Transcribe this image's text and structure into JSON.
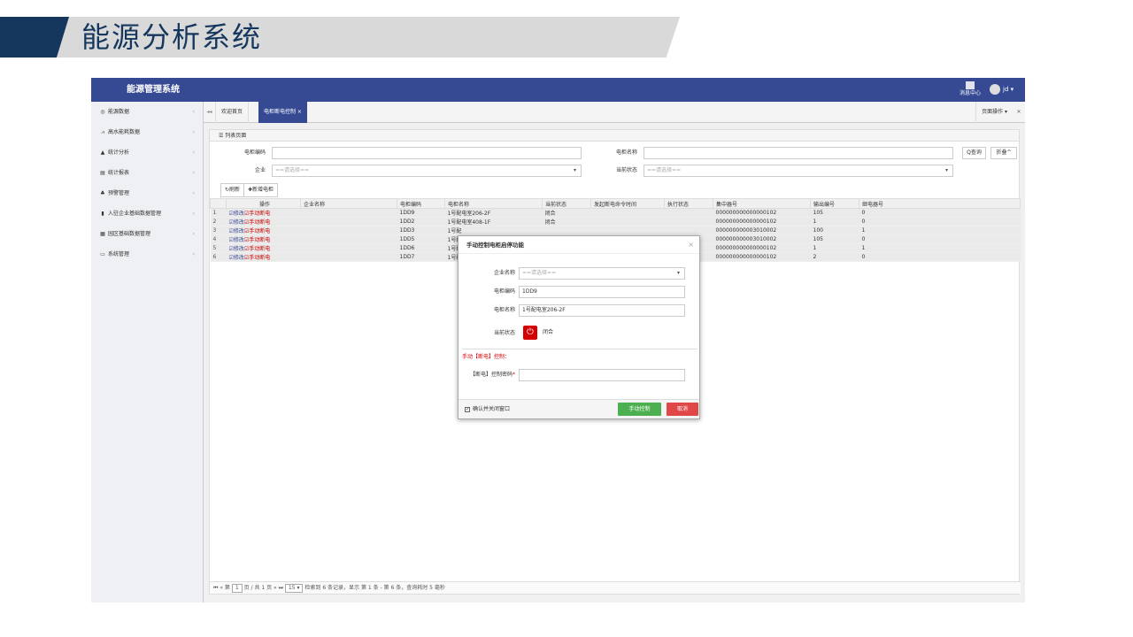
{
  "banner": {
    "title": "能源分析系统"
  },
  "header": {
    "app_title": "能源管理系统",
    "message_center": "消息中心",
    "user": "jd ▾"
  },
  "sidebar": {
    "items": [
      {
        "icon": "dashboard-icon",
        "glyph": "◎",
        "label": "能源数据"
      },
      {
        "icon": "tower-icon",
        "glyph": "⩘",
        "label": "高水能耗数据"
      },
      {
        "icon": "chart-icon",
        "glyph": "▲",
        "label": "统计分析"
      },
      {
        "icon": "table-icon",
        "glyph": "▤",
        "label": "统计报表"
      },
      {
        "icon": "bell-icon",
        "glyph": "♣",
        "label": "预警管理"
      },
      {
        "icon": "building-icon",
        "glyph": "▮",
        "label": "入驻企业基础数据管理"
      },
      {
        "icon": "park-icon",
        "glyph": "▦",
        "label": "园区基础数据管理"
      },
      {
        "icon": "monitor-icon",
        "glyph": "▭",
        "label": "系统管理"
      }
    ]
  },
  "tabs": {
    "first": "◂◂",
    "home": "欢迎首页",
    "active": "电柜断电控制 ×",
    "page_op": "页面操作 ▾",
    "fullscreen": "✕"
  },
  "search": {
    "list_title": "☰ 列表页面",
    "code_label": "电柜编码",
    "name_label": "电柜名称",
    "company_label": "企业",
    "company_placeholder": "==请选择==",
    "state_label": "当前状态",
    "state_placeholder": "==请选择==",
    "query": "Q查询",
    "collapse": "折叠^"
  },
  "toolbar": {
    "refresh": "↻刷新",
    "add": "✚新增电柜"
  },
  "grid": {
    "headers": [
      "",
      "操作",
      "企业名称",
      "电柜编码",
      "电柜名称",
      "当前状态",
      "发起断电命令时间",
      "执行状态",
      "集中器号",
      "输出编号",
      "继电器号"
    ],
    "rows": [
      {
        "n": "1",
        "edit": "☑修改",
        "cut": "☑手动断电",
        "company": "",
        "code": "1DD9",
        "name": "1号配电室206-2F",
        "state": "闭合",
        "time": "",
        "exec": "",
        "conc": "000000000000000102",
        "out": "105",
        "relay": "0"
      },
      {
        "n": "2",
        "edit": "☑修改",
        "cut": "☑手动断电",
        "company": "",
        "code": "1DD2",
        "name": "1号配电室408-1F",
        "state": "闭合",
        "time": "",
        "exec": "",
        "conc": "000000000000000102",
        "out": "1",
        "relay": "0"
      },
      {
        "n": "3",
        "edit": "☑修改",
        "cut": "☑手动断电",
        "company": "",
        "code": "1DD3",
        "name": "1号配",
        "state": "",
        "time": "",
        "exec": "",
        "conc": "000000000003010002",
        "out": "100",
        "relay": "1"
      },
      {
        "n": "4",
        "edit": "☑修改",
        "cut": "☑手动断电",
        "company": "",
        "code": "1DD5",
        "name": "1号配",
        "state": "",
        "time": "",
        "exec": "",
        "conc": "000000000003010002",
        "out": "105",
        "relay": "0"
      },
      {
        "n": "5",
        "edit": "☑修改",
        "cut": "☑手动断电",
        "company": "",
        "code": "1DD6",
        "name": "1号配",
        "state": "",
        "time": "",
        "exec": "",
        "conc": "000000000000000102",
        "out": "1",
        "relay": "1"
      },
      {
        "n": "6",
        "edit": "☑修改",
        "cut": "☑手动断电",
        "company": "",
        "code": "1DD7",
        "name": "1号配",
        "state": "",
        "time": "",
        "exec": "",
        "conc": "000000000000000102",
        "out": "2",
        "relay": "0"
      }
    ]
  },
  "pager": {
    "first": "⏮",
    "prev": "«",
    "page_prefix": "第",
    "page": "1",
    "page_suffix": "页 / 共 1 页",
    "next": "»",
    "last": "⏭",
    "size": "15 ▾",
    "summary": "检索到 6 条记录，显示 第 1 条 - 第 6 条，查询耗时 5 毫秒"
  },
  "modal": {
    "title": "手动控制电柜启停功能",
    "close": "×",
    "company_label": "企业名称",
    "company_placeholder": "==请选择==",
    "code_label": "电柜编码",
    "code_value": "1DD9",
    "name_label": "电柜名称",
    "name_value": "1号配电室206-2F",
    "state_label": "当前状态",
    "state_value": "闭合",
    "power_glyph": "⏻",
    "hint": "手动【断电】控制：",
    "pwd_label": "【断电】控制密码",
    "required": "*",
    "confirm_label": "确认并关闭窗口",
    "confirm_check": "✓",
    "submit": "手动控制",
    "cancel": "取消"
  },
  "colors": {
    "brand": "#364a94",
    "danger": "#d40000",
    "success": "#4caf50",
    "banner_dark": "#15375e"
  }
}
